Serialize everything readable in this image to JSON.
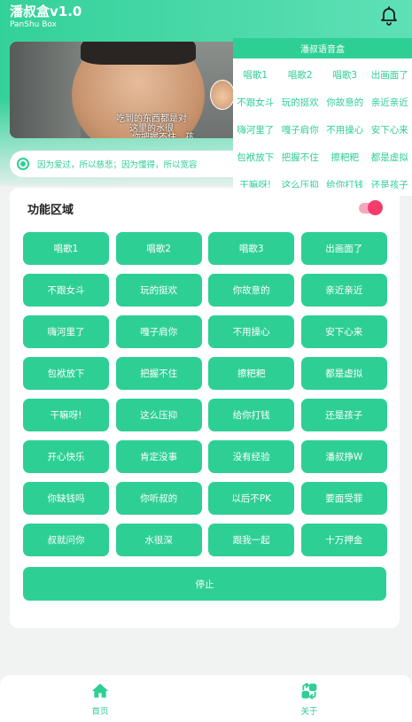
{
  "header": {
    "title": "潘叔盒v1.0",
    "subtitle": "PanShu Box"
  },
  "banner": {
    "subtitle_lines": [
      "吃到的东西都是对",
      "这里的水很",
      "你把握不住，孩"
    ]
  },
  "quote": "因为爱过，所以慈悲；因为懂得，所以宽容",
  "voice_panel": {
    "title": "潘叔语音盒",
    "items": [
      "唱歌1",
      "唱歌2",
      "唱歌3",
      "出画面了",
      "不跟女斗",
      "玩的挺欢",
      "你故意的",
      "亲近亲近",
      "嗨河里了",
      "嘎子肩你",
      "不用操心",
      "安下心来",
      "包袱放下",
      "把握不住",
      "擦粑粑",
      "都是虚拟",
      "干嘛呀!",
      "这么压抑",
      "给你打钱",
      "还是孩子"
    ]
  },
  "function_area": {
    "title": "功能区域",
    "toggle_on": true,
    "buttons": [
      "唱歌1",
      "唱歌2",
      "唱歌3",
      "出画面了",
      "不跟女斗",
      "玩的挺欢",
      "你故意的",
      "亲近亲近",
      "嗨河里了",
      "嘎子肩你",
      "不用操心",
      "安下心来",
      "包袱放下",
      "把握不住",
      "擦粑粑",
      "都是虚拟",
      "干嘛呀!",
      "这么压抑",
      "给你打钱",
      "还是孩子",
      "开心快乐",
      "肯定没事",
      "没有经验",
      "潘叔挣W",
      "你缺钱吗",
      "你听叔的",
      "以后不PK",
      "要面受罪",
      "叔就问你",
      "水很深",
      "跟我一起",
      "十万押金"
    ],
    "stop_label": "停止"
  },
  "nav": {
    "home_label": "首页",
    "about_label": "关于"
  },
  "colors": {
    "accent": "#2ecf95",
    "toggle": "#f43c6c"
  }
}
